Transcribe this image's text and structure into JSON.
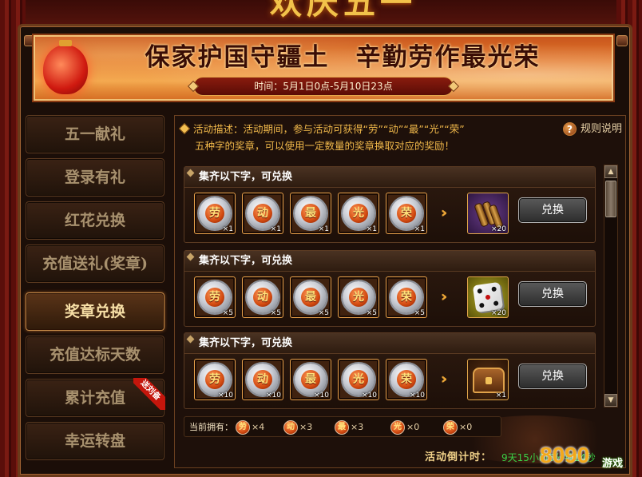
{
  "header": {
    "title": "欢庆五一"
  },
  "banner": {
    "title": "保家护国守疆土　辛勤劳作最光荣",
    "time": "时间：5月1日0点-5月10日23点"
  },
  "sidebar": {
    "items": [
      {
        "label": "五一献礼"
      },
      {
        "label": "登录有礼"
      },
      {
        "label": "红花兑换"
      },
      {
        "label": "充值送礼(奖章)"
      },
      {
        "label": "奖章兑换"
      },
      {
        "label": "充值达标天数"
      },
      {
        "label": "累计充值",
        "badge": "送刘备"
      },
      {
        "label": "幸运转盘"
      }
    ],
    "active_index": 4
  },
  "panel": {
    "desc_line1": "活动描述：活动期间，参与活动可获得“劳”“动”“最”“光”“荣”",
    "desc_line2": "五种字的奖章，可以使用一定数量的奖章换取对应的奖励！",
    "rules_label": "规则说明",
    "rules_icon": "?"
  },
  "medals": [
    "劳",
    "动",
    "最",
    "光",
    "荣"
  ],
  "rows": [
    {
      "title": "集齐以下字，可兑换",
      "counts": [
        "×1",
        "×1",
        "×1",
        "×1",
        "×1"
      ],
      "reward_count": "×20",
      "reward_icon": "wood-logs-icon",
      "button": "兑换"
    },
    {
      "title": "集齐以下字，可兑换",
      "counts": [
        "×5",
        "×5",
        "×5",
        "×5",
        "×5"
      ],
      "reward_count": "×20",
      "reward_icon": "dice-icon",
      "button": "兑换"
    },
    {
      "title": "集齐以下字，可兑换",
      "counts": [
        "×10",
        "×10",
        "×10",
        "×10",
        "×10"
      ],
      "reward_count": "×1",
      "reward_icon": "treasure-chest-icon",
      "button": "兑换"
    }
  ],
  "inventory": {
    "label": "当前拥有：",
    "items": [
      {
        "char": "劳",
        "count": "×4"
      },
      {
        "char": "动",
        "count": "×3"
      },
      {
        "char": "最",
        "count": "×3"
      },
      {
        "char": "光",
        "count": "×0"
      },
      {
        "char": "荣",
        "count": "×0"
      }
    ]
  },
  "countdown": {
    "label": "活动倒计时：",
    "value": "9天15小时6分钟14秒"
  },
  "watermark": {
    "main": "8090",
    "sub": "游戏"
  },
  "colors": {
    "accent_gold": "#f0b84a",
    "countdown_green": "#3ad046",
    "badge_red": "#c4160c"
  }
}
